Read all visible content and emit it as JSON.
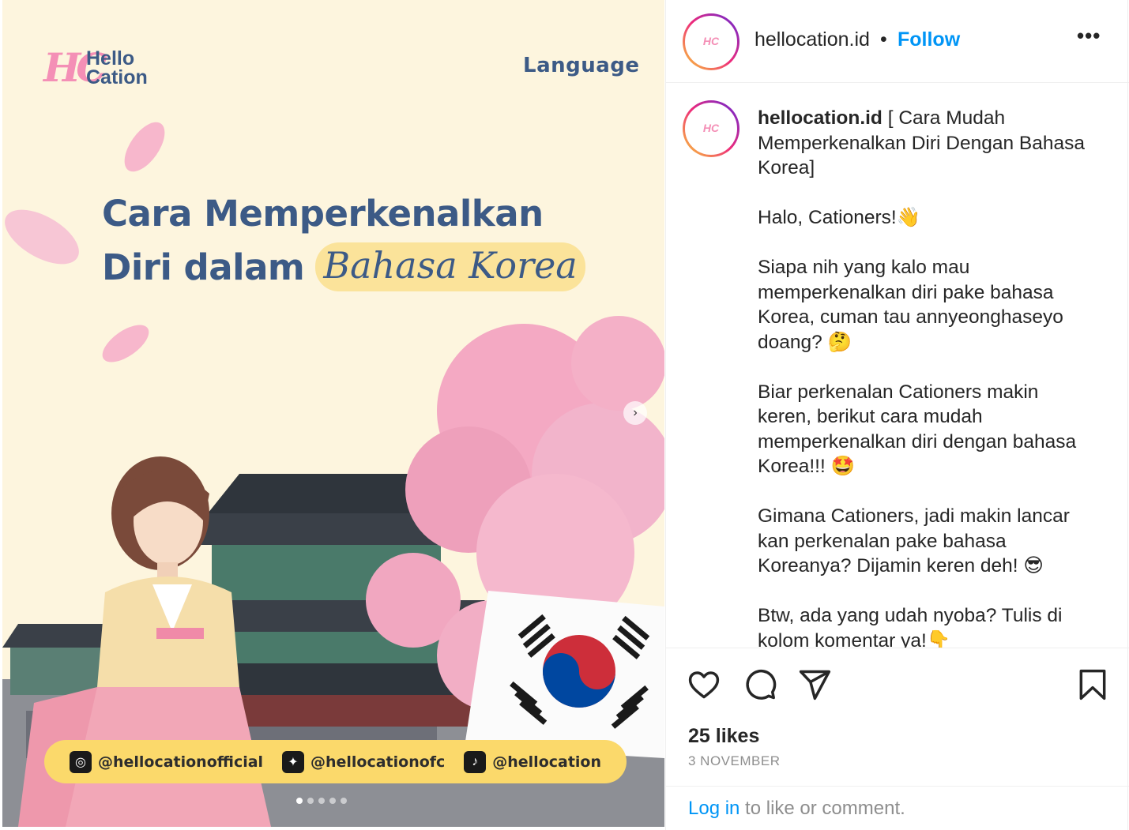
{
  "post_image": {
    "brand_hc": "HC",
    "brand_line1": "Hello",
    "brand_line2": "Cation",
    "category": "Language",
    "headline_line1": "Cara Memperkenalkan",
    "headline_line2_plain": "Diri dalam",
    "headline_line2_highlight": "Bahasa Korea",
    "socials": [
      {
        "icon": "instagram-icon",
        "glyph": "◎",
        "handle": "@hellocationofficial"
      },
      {
        "icon": "twitter-icon",
        "glyph": "✦",
        "handle": "@hellocationofc"
      },
      {
        "icon": "tiktok-icon",
        "glyph": "♪",
        "handle": "@hellocation"
      }
    ],
    "colors": {
      "background": "#fdf5de",
      "headline": "#3c5a86",
      "highlight": "#fbe39a",
      "social_bar": "#fbd96b",
      "petal": "#f7b7cc"
    }
  },
  "header": {
    "username": "hellocation.id",
    "separator": "•",
    "follow_label": "Follow",
    "more_label": "•••"
  },
  "caption": {
    "username": "hellocation.id",
    "text": " [ Cara Mudah Memperkenalkan Diri Dengan Bahasa Korea]\n\nHalo, Cationers!👋\n\nSiapa nih yang kalo mau memperkenalkan diri pake bahasa Korea, cuman tau annyeonghaseyo doang? 🤔\n\nBiar perkenalan Cationers makin keren, berikut cara mudah memperkenalkan diri dengan bahasa Korea!!! 🤩\n\nGimana Cationers, jadi makin lancar kan perkenalan pake bahasa Koreanya? Dijamin keren deh! 😎\n\nBtw, ada yang udah nyoba? Tulis di kolom komentar ya!👇"
  },
  "engagement": {
    "likes": "25 likes",
    "date": "3 NOVEMBER"
  },
  "login": {
    "link": "Log in",
    "rest": " to like or comment."
  },
  "accent": "#0095f6"
}
